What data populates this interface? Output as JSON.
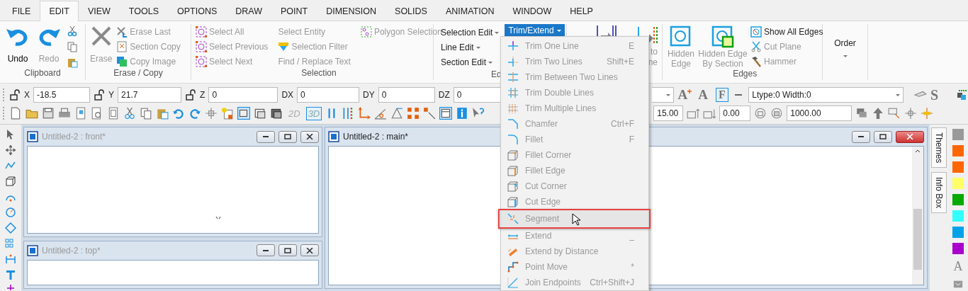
{
  "menu_bar": {
    "tabs": [
      {
        "label": "FILE",
        "selected": false
      },
      {
        "label": "EDIT",
        "selected": true
      },
      {
        "label": "VIEW",
        "selected": false
      },
      {
        "label": "TOOLS",
        "selected": false
      },
      {
        "label": "OPTIONS",
        "selected": false
      },
      {
        "label": "DRAW",
        "selected": false
      },
      {
        "label": "POINT",
        "selected": false
      },
      {
        "label": "DIMENSION",
        "selected": false
      },
      {
        "label": "SOLIDS",
        "selected": false
      },
      {
        "label": "ANIMATION",
        "selected": false
      },
      {
        "label": "WINDOW",
        "selected": false
      },
      {
        "label": "HELP",
        "selected": false
      }
    ]
  },
  "clipboard": {
    "label": "Clipboard",
    "buttons": [
      {
        "label": "Undo",
        "disabled": false
      },
      {
        "label": "Redo",
        "disabled": true
      }
    ]
  },
  "erase_copy": {
    "label": "Erase / Copy",
    "erase": {
      "label": "Erase",
      "disabled": true
    },
    "items": [
      {
        "label": "Erase Last",
        "disabled": true
      },
      {
        "label": "Section Copy",
        "disabled": true
      },
      {
        "label": "Copy Image",
        "disabled": true
      }
    ]
  },
  "selection": {
    "label": "Selection",
    "items": [
      {
        "label": "Select All",
        "disabled": true
      },
      {
        "label": "Select Previous",
        "disabled": true
      },
      {
        "label": "Select Next",
        "disabled": true
      },
      {
        "label": "Select Entity",
        "disabled": true
      },
      {
        "label": "Selection Filter",
        "disabled": true
      },
      {
        "label": "Find / Replace Text",
        "disabled": true
      },
      {
        "label": "Polygon Selection",
        "disabled": true
      }
    ]
  },
  "edit": {
    "label": "Ed",
    "dropdowns": [
      {
        "label": "Selection Edit",
        "disabled": false
      },
      {
        "label": "Line Edit",
        "disabled": false
      },
      {
        "label": "Section Edit",
        "disabled": false
      }
    ],
    "trim_extend": {
      "label": "Trim/Extend",
      "expanded": true
    }
  },
  "convert": {
    "label_lines": [
      "to",
      "ne"
    ]
  },
  "edges": {
    "label": "Edges",
    "big_buttons": [
      {
        "label": "Hidden Edge",
        "disabled": true
      },
      {
        "label": "Hidden Edge By Section",
        "disabled": true
      }
    ],
    "items": [
      {
        "label": "Show All Edges",
        "disabled": false
      },
      {
        "label": "Cut Plane",
        "disabled": true
      },
      {
        "label": "Hammer",
        "disabled": true
      }
    ]
  },
  "order": {
    "label": "Order"
  },
  "coordinates": [
    {
      "label": "X",
      "value": "-18.5",
      "locked": true
    },
    {
      "label": "Y",
      "value": "21.7",
      "locked": true
    },
    {
      "label": "Z",
      "value": "0",
      "locked": true
    },
    {
      "label": "DX",
      "value": "0",
      "locked": false
    },
    {
      "label": "DY",
      "value": "0",
      "locked": false
    },
    {
      "label": "DZ",
      "value": "0",
      "locked": false
    }
  ],
  "text_tools": [
    "A",
    "A",
    "F"
  ],
  "line_style": "Ltype:0  Width:0",
  "style_glyph": "S",
  "view_modes": [
    {
      "label": "2D",
      "selected": false
    },
    {
      "label": "3D",
      "selected": true
    }
  ],
  "number_fields": [
    "15.00",
    "0.00",
    "1000.00"
  ],
  "windows": [
    {
      "title": "Untitled-2 : front*",
      "active": false
    },
    {
      "title": "Untitled-2 : top*",
      "active": false
    },
    {
      "title": "Untitled-2 : main*",
      "active": true
    }
  ],
  "side_tabs": [
    "Themes",
    "Info Box"
  ],
  "palette": [
    {
      "color": "#999999"
    },
    {
      "color": "#ff6600"
    },
    {
      "color": "#ff6600"
    },
    {
      "color": "#ffff66"
    },
    {
      "color": "#00aa00"
    },
    {
      "color": "#33ffff"
    },
    {
      "color": "#00a2e8"
    },
    {
      "color": "#aa00cc"
    }
  ],
  "palette_glyph": "A",
  "dropdown": {
    "items": [
      {
        "label": "Trim One Line",
        "shortcut": "E",
        "disabled": true,
        "selected": false
      },
      {
        "label": "Trim Two Lines",
        "shortcut": "Shift+E",
        "disabled": true,
        "selected": false
      },
      {
        "label": "Trim Between Two Lines",
        "disabled": true,
        "selected": false
      },
      {
        "label": "Trim Double Lines",
        "disabled": true,
        "selected": false
      },
      {
        "label": "Trim Multiple Lines",
        "disabled": true,
        "selected": false
      },
      {
        "label": "Chamfer",
        "shortcut": "Ctrl+F",
        "disabled": true,
        "selected": false
      },
      {
        "label": "Fillet",
        "shortcut": "F",
        "disabled": true,
        "selected": false
      },
      {
        "label": "Fillet Corner",
        "disabled": true,
        "selected": false
      },
      {
        "label": "Fillet Edge",
        "disabled": true,
        "selected": false
      },
      {
        "label": "Cut Corner",
        "disabled": true,
        "selected": false
      },
      {
        "label": "Cut Edge",
        "disabled": true,
        "selected": false
      },
      {
        "label": "Segment",
        "disabled": true,
        "selected": true
      },
      {
        "label": "Extend",
        "shortcut": "_",
        "disabled": true,
        "selected": false
      },
      {
        "label": "Extend by Distance",
        "disabled": true,
        "selected": false
      },
      {
        "label": "Point Move",
        "shortcut": "*",
        "disabled": true,
        "selected": false
      },
      {
        "label": "Join Endpoints",
        "shortcut": "Ctrl+Shift+J",
        "disabled": true,
        "selected": false
      }
    ]
  }
}
